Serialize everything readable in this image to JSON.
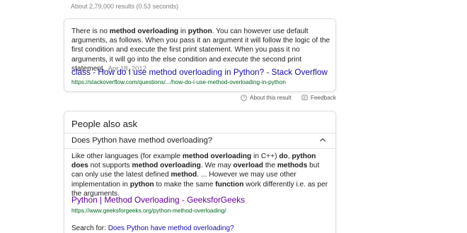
{
  "result_stats": "About 2,79,000 results (0.53 seconds)",
  "snippet": {
    "segments": [
      {
        "text": "There is no ",
        "bold": false
      },
      {
        "text": "method overloading",
        "bold": true
      },
      {
        "text": " in ",
        "bold": false
      },
      {
        "text": "python",
        "bold": true
      },
      {
        "text": ". You can however use default arguments, as follows. When you pass it an argument it will follow the logic of the first condition and execute the first print statement. When you pass it no arguments, it will go into the else condition and execute the second print statement.",
        "bold": false
      }
    ],
    "date": "Apr 18, 2012",
    "title": "class - How do I use method overloading in Python? - Stack Overflow",
    "url": "https://stackoverflow.com/questions/.../how-do-i-use-method-overloading-in-python"
  },
  "about_row": {
    "about_label": "About this result",
    "feedback_label": "Feedback"
  },
  "people_also_ask": {
    "heading": "People also ask",
    "question": "Does Python have method overloading?",
    "answer_segments": [
      {
        "text": "Like other languages (for example ",
        "bold": false
      },
      {
        "text": "method overloading",
        "bold": true
      },
      {
        "text": " in C++) ",
        "bold": false
      },
      {
        "text": "do",
        "bold": true
      },
      {
        "text": ", ",
        "bold": false
      },
      {
        "text": "python does",
        "bold": true
      },
      {
        "text": " not supports ",
        "bold": false
      },
      {
        "text": "method overloading",
        "bold": true
      },
      {
        "text": ". We may ",
        "bold": false
      },
      {
        "text": "overload",
        "bold": true
      },
      {
        "text": " the ",
        "bold": false
      },
      {
        "text": "methods",
        "bold": true
      },
      {
        "text": " but can only use the latest defined ",
        "bold": false
      },
      {
        "text": "method",
        "bold": true
      },
      {
        "text": ". ... However we may use other implementation in ",
        "bold": false
      },
      {
        "text": "python",
        "bold": true
      },
      {
        "text": " to make the same ",
        "bold": false
      },
      {
        "text": "function",
        "bold": true
      },
      {
        "text": " work differently i.e. as per the arguments.",
        "bold": false
      }
    ],
    "result_title": "Python | Method Overloading - GeeksforGeeks",
    "result_url": "https://www.geeksforgeeks.org/python-method-overloading/",
    "search_for_label": "Search for:",
    "search_for_link": "Does Python have method overloading?"
  }
}
